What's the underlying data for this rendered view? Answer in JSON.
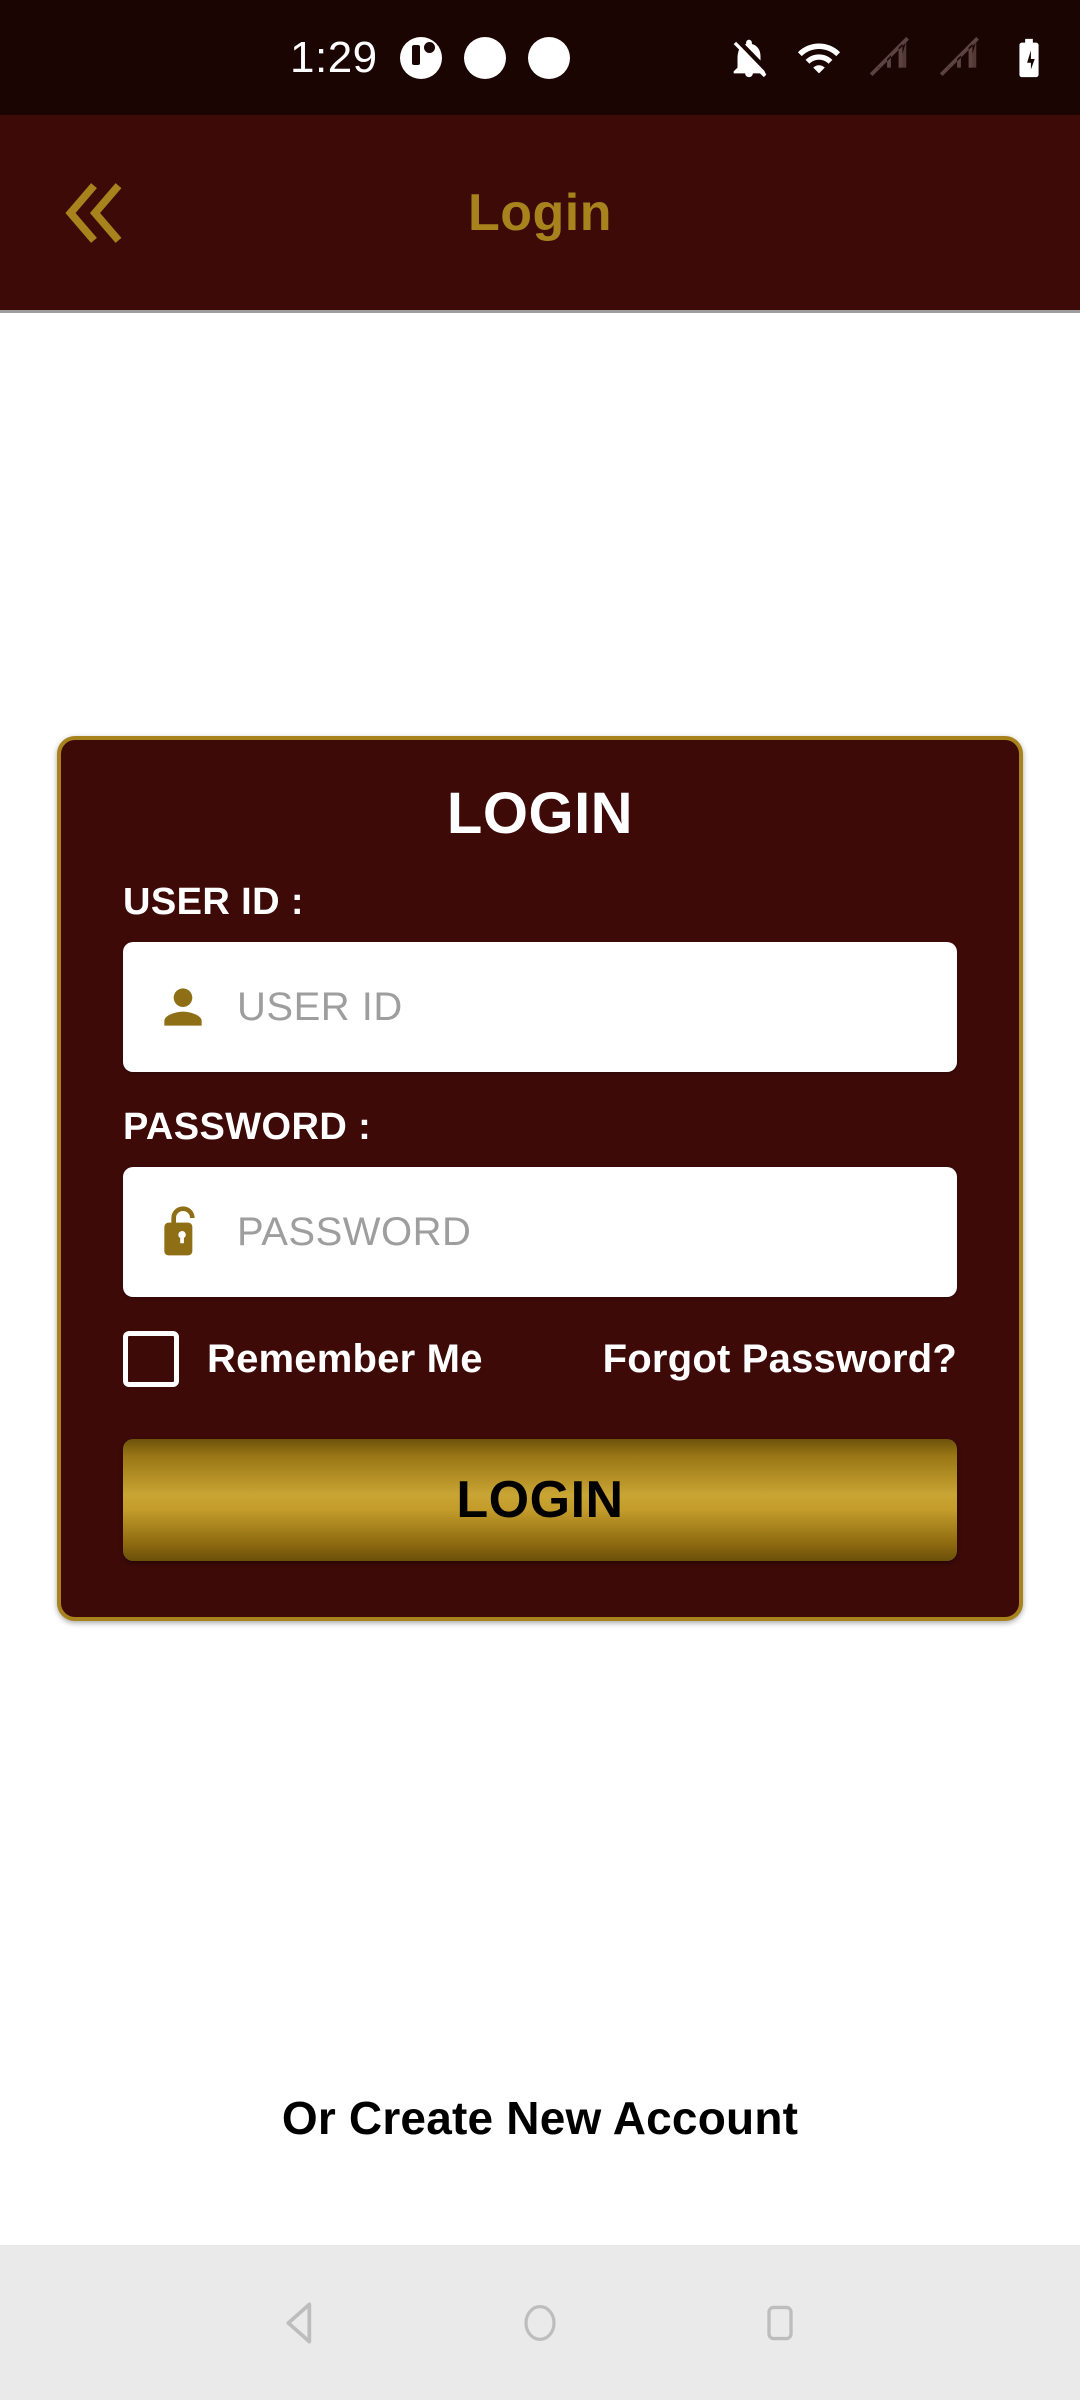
{
  "status_bar": {
    "time": "1:29",
    "background_color": "#1B0503",
    "icons": [
      "notification-circle-icon",
      "notification-dot-icon",
      "notification-dot-icon",
      "notifications-off-icon",
      "wifi-icon",
      "signal-off-icon",
      "signal-off-icon",
      "battery-charging-icon"
    ]
  },
  "app_bar": {
    "title": "Login",
    "back_icon": "double-chevron-left-icon",
    "background_color": "#3D0A08",
    "title_color": "#A8821C"
  },
  "login_card": {
    "title": "LOGIN",
    "background_color": "#3D0A08",
    "border_color": "#A8821C",
    "user_id": {
      "label": "USER ID :",
      "placeholder": "USER ID",
      "value": "",
      "icon": "person-icon"
    },
    "password": {
      "label": "PASSWORD :",
      "placeholder": "PASSWORD",
      "value": "",
      "icon": "unlock-icon"
    },
    "remember_me": {
      "label": "Remember Me",
      "checked": false
    },
    "forgot_password": {
      "label": "Forgot Password?"
    },
    "submit": {
      "label": "LOGIN",
      "accent_color": "#C9A534"
    }
  },
  "footer": {
    "create_account": "Or Create New Account"
  },
  "nav_bar": {
    "background_color": "#EAEAEA",
    "buttons": [
      {
        "name": "back",
        "icon": "triangle-back-icon"
      },
      {
        "name": "home",
        "icon": "circle-home-icon"
      },
      {
        "name": "recents",
        "icon": "square-recents-icon"
      }
    ]
  }
}
